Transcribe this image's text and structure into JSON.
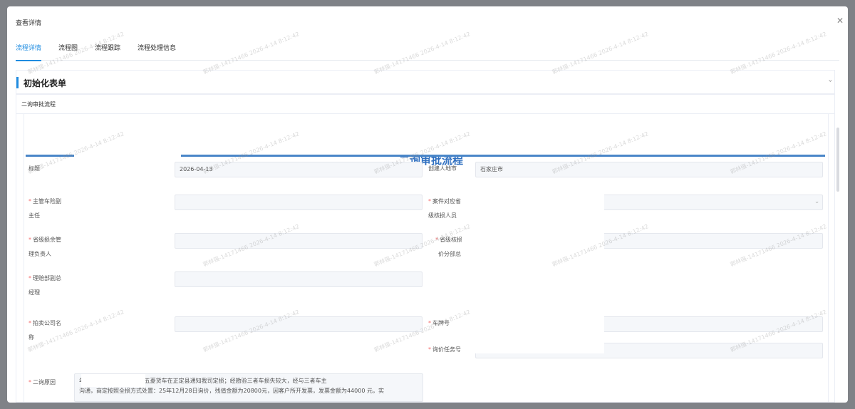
{
  "modal": {
    "title": "查看详情",
    "tabs": [
      {
        "label": "流程详情",
        "active": true
      },
      {
        "label": "流程图",
        "active": false
      },
      {
        "label": "流程跟踪",
        "active": false
      },
      {
        "label": "流程处理信息",
        "active": false
      }
    ]
  },
  "section": {
    "title": "初始化表单",
    "panel_label": "二询审批流程"
  },
  "form": {
    "title": "二询审批流程",
    "fields": {
      "title_label": "标题",
      "title_value": "2026-04-13",
      "creator_city_label": "创建人地市",
      "creator_city_value": "石家庄市",
      "vp_label_1": "主管车险副",
      "vp_label_2": "主任",
      "case_reviewer_label_1": "案件对应省",
      "case_reviewer_label_2": "级核损人员",
      "province_manager_label_1": "省级损余管",
      "province_manager_label_2": "理负责人",
      "province_price_label_1": "省级核损",
      "province_price_label_2": "价分部总",
      "claims_gm_label_1": "理赔部副总",
      "claims_gm_label_2": "经理",
      "auction_company_label_1": "拍卖公司名",
      "auction_company_label_2": "称",
      "plate_label": "车牌号",
      "inquiry_task_label": "询价任务号",
      "reason_label": "二询原因",
      "reason_text_1": "年12月26日三者AE929X五菱货车在正定县通知我司定损；经勘验三者车损失较大，经与三者车主",
      "reason_text_2": "沟通，商定按照全损方式处置：25年12月28日询价，残值金额为20800元，因客户所开发票，发票金额为44000 元，实"
    }
  },
  "watermark": {
    "text": "郭林强-14171466  2026-4-14 8:12:42"
  }
}
